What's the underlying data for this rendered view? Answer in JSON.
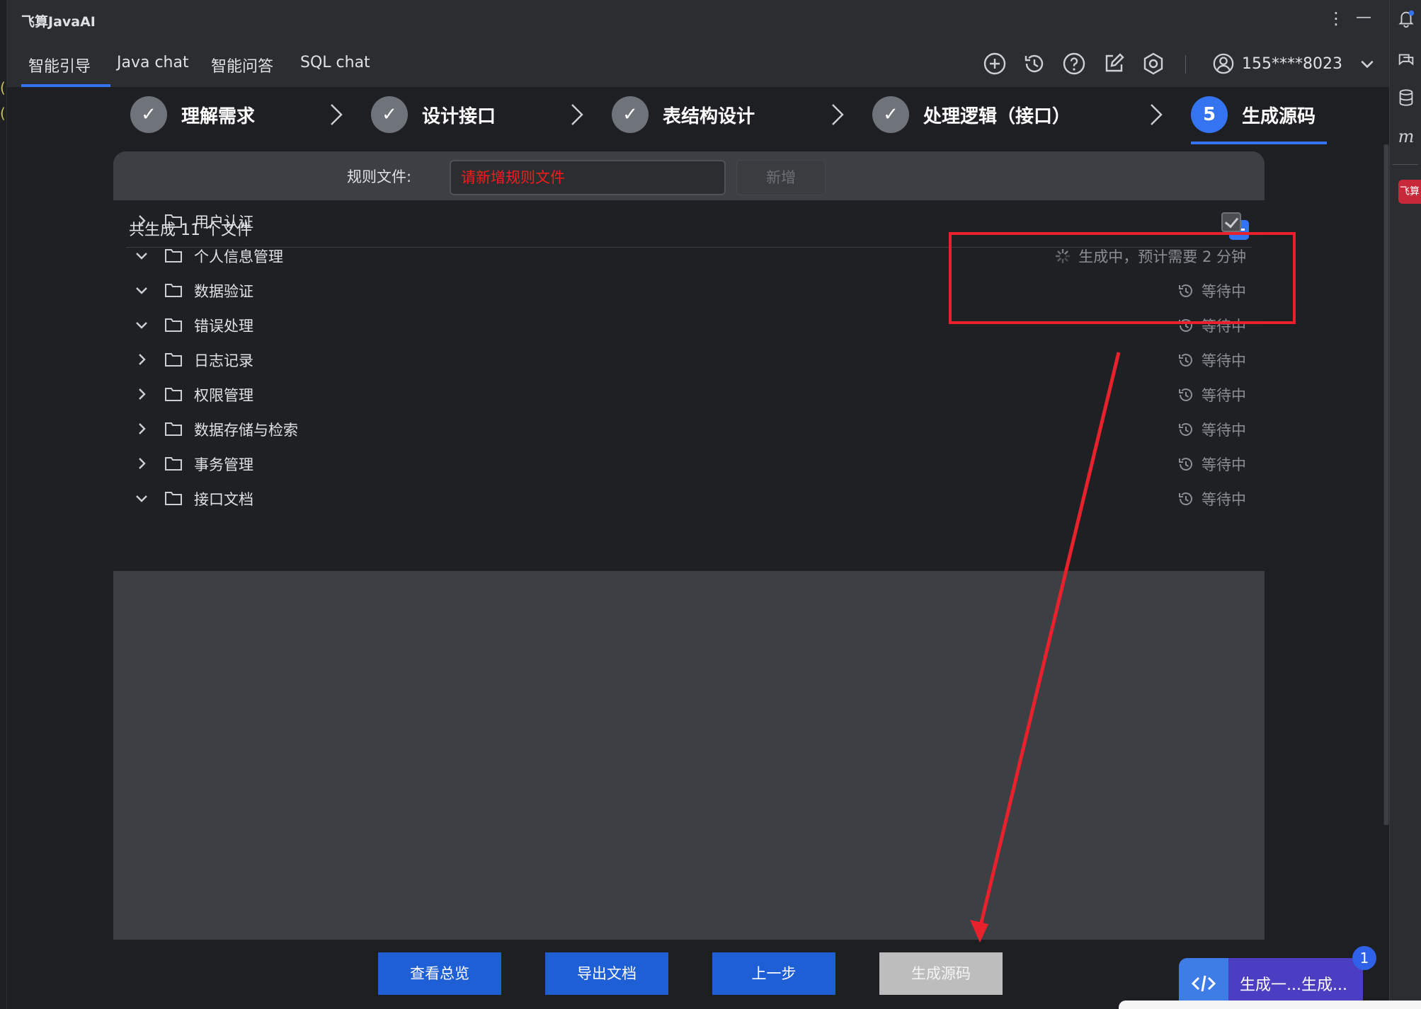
{
  "app": {
    "title": "飞算JavaAI"
  },
  "tabs": [
    {
      "label": "智能引导",
      "active": true
    },
    {
      "label": "Java chat",
      "active": false
    },
    {
      "label": "智能问答",
      "active": false
    },
    {
      "label": "SQL chat",
      "active": false
    }
  ],
  "toolbar": {
    "icons": [
      "add-circle-icon",
      "history-icon",
      "help-icon",
      "edit-icon",
      "settings-icon"
    ],
    "user": "155****8023"
  },
  "steps": [
    {
      "label": "理解需求",
      "state": "done",
      "mark": "✓"
    },
    {
      "label": "设计接口",
      "state": "done",
      "mark": "✓"
    },
    {
      "label": "表结构设计",
      "state": "done",
      "mark": "✓"
    },
    {
      "label": "处理逻辑（接口）",
      "state": "done",
      "mark": "✓"
    },
    {
      "label": "生成源码",
      "state": "active",
      "mark": "5"
    }
  ],
  "rules": {
    "label": "规则文件:",
    "placeholder": "请新增规则文件",
    "add_label": "新增"
  },
  "files": {
    "header": "共生成 11 个文件",
    "items": [
      {
        "name": "用户认证",
        "expanded": false,
        "status": ""
      },
      {
        "name": "个人信息管理",
        "expanded": true,
        "status": "生成中，预计需要 2 分钟"
      },
      {
        "name": "数据验证",
        "expanded": true,
        "status": "等待中"
      },
      {
        "name": "错误处理",
        "expanded": true,
        "status": "等待中"
      },
      {
        "name": "日志记录",
        "expanded": false,
        "status": "等待中"
      },
      {
        "name": "权限管理",
        "expanded": false,
        "status": "等待中"
      },
      {
        "name": "数据存储与检索",
        "expanded": false,
        "status": "等待中"
      },
      {
        "name": "事务管理",
        "expanded": false,
        "status": "等待中"
      },
      {
        "name": "接口文档",
        "expanded": true,
        "status": "等待中"
      }
    ]
  },
  "buttons": {
    "overview": "查看总览",
    "export": "导出文档",
    "prev": "上一步",
    "generate": "生成源码"
  },
  "float_widget": {
    "text": "生成一...生成...",
    "badge": "1"
  },
  "sidebar_right": {
    "badge": "飞算"
  },
  "colors": {
    "accent": "#3574f0",
    "annotation": "#e8222d",
    "placeholder_text": "#f01d1d"
  }
}
